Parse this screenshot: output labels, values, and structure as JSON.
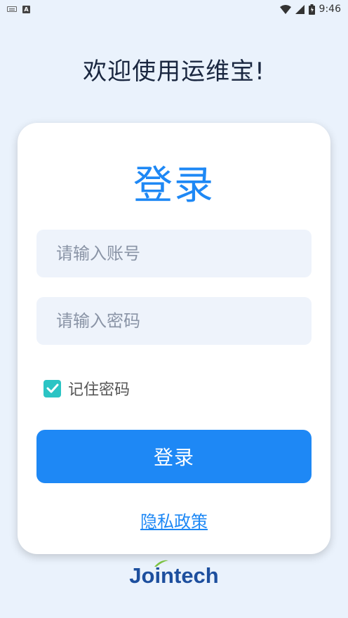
{
  "status_bar": {
    "time": "9:46"
  },
  "welcome": "欢迎使用运维宝!",
  "card": {
    "title": "登录",
    "account_placeholder": "请输入账号",
    "password_placeholder": "请输入密码",
    "remember_label": "记住密码",
    "remember_checked": true,
    "login_label": "登录",
    "privacy_label": "隐私政策"
  },
  "brand": {
    "name": "Jointech"
  },
  "colors": {
    "primary": "#1e88f5",
    "checkbox": "#2bc4c4",
    "background": "#eaf2fc"
  }
}
